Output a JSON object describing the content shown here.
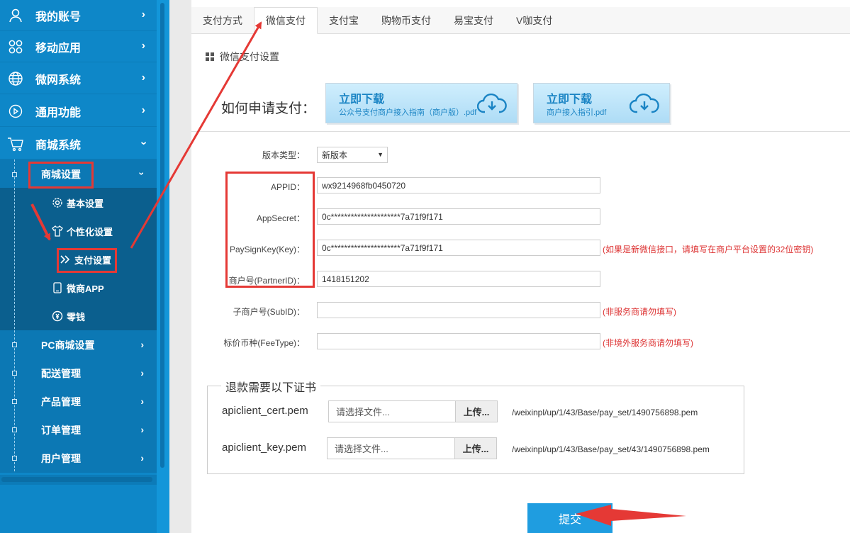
{
  "sidebar": {
    "top_items": [
      {
        "label": "我的账号",
        "icon": "user-icon"
      },
      {
        "label": "移动应用",
        "icon": "apps-icon"
      },
      {
        "label": "微网系统",
        "icon": "globe-icon"
      },
      {
        "label": "通用功能",
        "icon": "play-icon"
      },
      {
        "label": "商城系统",
        "icon": "cart-icon"
      }
    ],
    "mall_settings": {
      "label": "商城设置",
      "children": [
        {
          "label": "基本设置",
          "icon": "gear-icon"
        },
        {
          "label": "个性化设置",
          "icon": "shirt-icon"
        },
        {
          "label": "支付设置",
          "icon": "double-chevron-icon"
        },
        {
          "label": "微商APP",
          "icon": "phone-icon"
        },
        {
          "label": "零钱",
          "icon": "coin-icon"
        }
      ]
    },
    "sub_items": [
      "PC商城设置",
      "配送管理",
      "产品管理",
      "订单管理",
      "用户管理"
    ]
  },
  "tabs": [
    "支付方式",
    "微信支付",
    "支付宝",
    "购物币支付",
    "易宝支付",
    "V咖支付"
  ],
  "active_tab": "微信支付",
  "section_title": "微信支付设置",
  "howto": {
    "label": "如何申请支付：",
    "download_1": {
      "title": "立即下载",
      "subtitle": "公众号支付商户接入指南（商户版）.pdf"
    },
    "download_2": {
      "title": "立即下载",
      "subtitle": "商户接入指引.pdf"
    }
  },
  "form": {
    "version_label": "版本类型：",
    "version_value": "新版本",
    "appid_label": "APPID：",
    "appid_value": "wx9214968fb0450720",
    "appsecret_label": "AppSecret：",
    "appsecret_value": "0c*********************7a71f9f171",
    "paysignkey_label": "PaySignKey(Key)：",
    "paysignkey_value": "0c*********************7a71f9f171",
    "paysignkey_hint": "(如果是新微信接口，请填写在商户平台设置的32位密钥)",
    "partnerid_label": "商户号(PartnerID)：",
    "partnerid_value": "1418151202",
    "subid_label": "子商户号(SubID)：",
    "subid_value": "",
    "subid_hint": "(非服务商请勿填写)",
    "feetype_label": "标价币种(FeeType)：",
    "feetype_value": "",
    "feetype_hint": "(非境外服务商请勿填写)"
  },
  "certs": {
    "legend": "退款需要以下证书",
    "cert": {
      "label": "apiclient_cert.pem",
      "placeholder": "请选择文件...",
      "button": "上传...",
      "path": "/weixinpl/up/1/43/Base/pay_set/1490756898.pem"
    },
    "key": {
      "label": "apiclient_key.pem",
      "placeholder": "请选择文件...",
      "button": "上传...",
      "path": "/weixinpl/up/1/43/Base/pay_set/43/1490756898.pem"
    }
  },
  "submit_label": "提交",
  "colors": {
    "sidebar": "#0e87c8",
    "accent": "#1f9de0",
    "annotation": "#e53935",
    "hint": "#dd3333"
  }
}
